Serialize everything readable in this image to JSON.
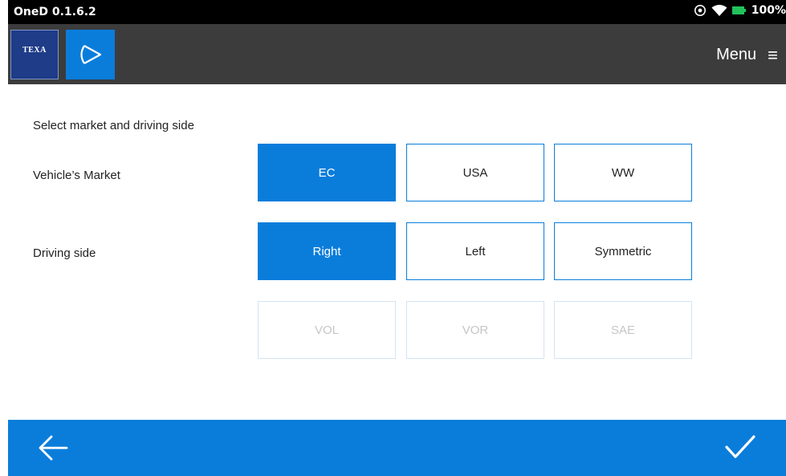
{
  "status_bar": {
    "app_version": "OneD 0.1.6.2",
    "battery": "100%"
  },
  "header": {
    "logo_text": "TEXA",
    "menu_label": "Menu"
  },
  "main": {
    "prompt": "Select market and driving side",
    "market": {
      "label": "Vehicle’s Market",
      "options": [
        "EC",
        "USA",
        "WW"
      ],
      "selected": "EC"
    },
    "driving_side": {
      "label": "Driving side",
      "options": [
        "Right",
        "Left",
        "Symmetric"
      ],
      "selected": "Right"
    },
    "standards": {
      "options": [
        "VOL",
        "VOR",
        "SAE"
      ],
      "enabled": false
    }
  },
  "colors": {
    "accent": "#0a7ddb",
    "header_bg": "#3c3c3c",
    "status_bg": "#000000",
    "texa_blue": "#1f3c88"
  },
  "icons": {
    "back": "arrow-left-icon",
    "confirm": "checkmark-icon",
    "menu": "hamburger-icon"
  }
}
